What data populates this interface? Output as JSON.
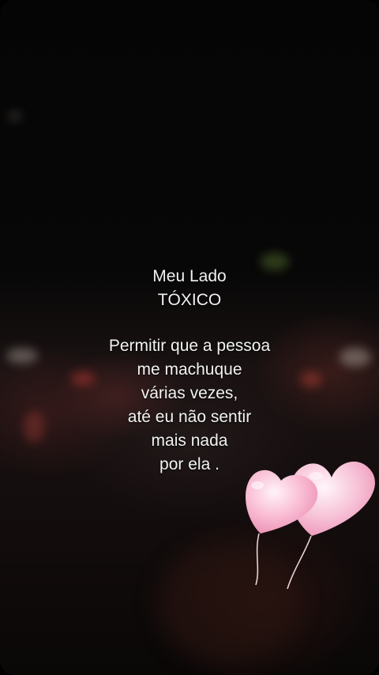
{
  "caption": {
    "title_line_1": "Meu Lado",
    "title_line_2": "TÓXICO",
    "body_lines": [
      "Permitir que a pessoa",
      "me machuque",
      "várias vezes,",
      "até eu não sentir",
      "mais nada",
      "por ela ."
    ]
  },
  "decoration": {
    "icon": "heart-balloons-icon",
    "color": "#f7b6cf"
  }
}
